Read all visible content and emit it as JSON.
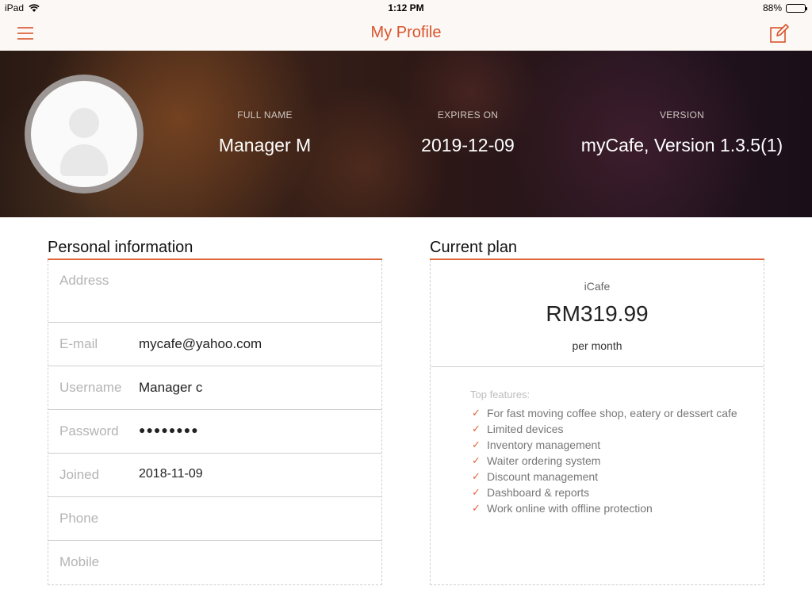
{
  "status_bar": {
    "device": "iPad",
    "time": "1:12 PM",
    "battery": "88%",
    "battery_level": 0.88
  },
  "nav": {
    "title": "My Profile",
    "menu_icon": "hamburger-menu-icon",
    "edit_icon": "edit-icon"
  },
  "profile": {
    "full_name_label": "FULL NAME",
    "full_name": "Manager M",
    "expires_label": "EXPIRES ON",
    "expires": "2019-12-09",
    "version_label": "VERSION",
    "version": "myCafe, Version 1.3.5(1)"
  },
  "personal": {
    "title": "Personal information",
    "fields": [
      {
        "label": "Address",
        "value": ""
      },
      {
        "label": "E-mail",
        "value": "mycafe@yahoo.com"
      },
      {
        "label": "Username",
        "value": "Manager c"
      },
      {
        "label": "Password",
        "value": "●●●●●●●●"
      },
      {
        "label": "Joined",
        "value": "2018-11-09"
      },
      {
        "label": "Phone",
        "value": ""
      },
      {
        "label": "Mobile",
        "value": ""
      }
    ]
  },
  "plan": {
    "title": "Current plan",
    "name": "iCafe",
    "price": "RM319.99",
    "period": "per month",
    "features_title": "Top features:",
    "features": [
      "For fast moving coffee shop, eatery or dessert cafe",
      "Limited devices",
      "Inventory management",
      "Waiter ordering system",
      "Discount management",
      "Dashboard & reports",
      "Work online with offline protection"
    ]
  },
  "colors": {
    "accent": "#d9532c",
    "navbar_bg": "#fcf8f5"
  }
}
